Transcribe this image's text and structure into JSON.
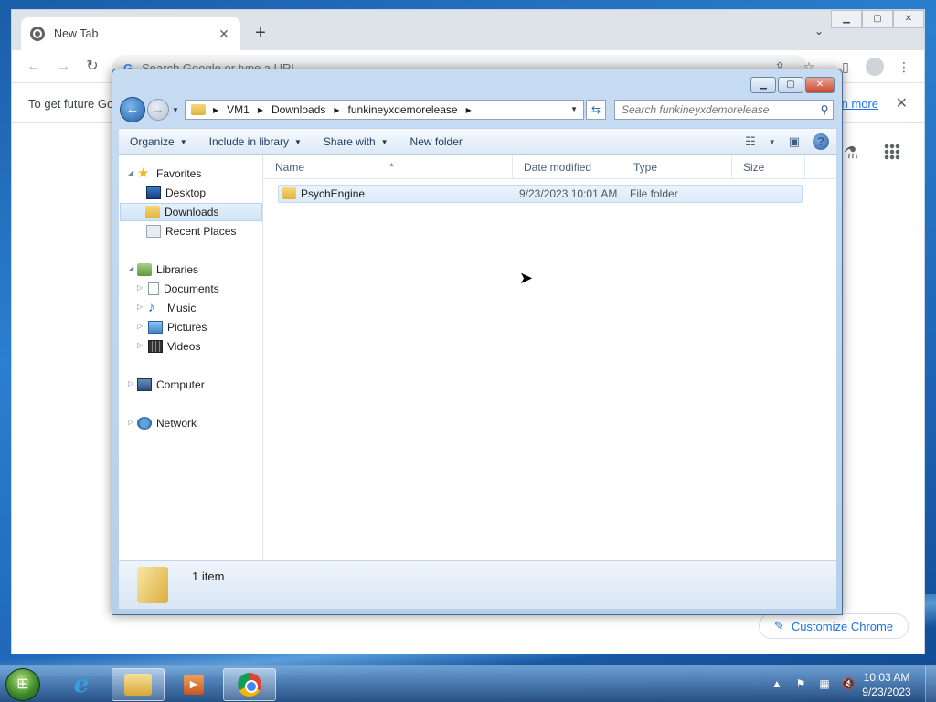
{
  "chrome": {
    "tab_title": "New Tab",
    "tab_close": "✕",
    "new_tab": "+",
    "omnibox_placeholder": "Search Google or type a URL",
    "omnibox_icon": "G",
    "infobar_text": "To get future Go",
    "infobar_link": "n more",
    "customize_label": "Customize Chrome",
    "icons": [
      "back-arrow-icon",
      "forward-arrow-icon",
      "reload-icon",
      "share-icon",
      "bookmark-star-icon",
      "side-panel-icon",
      "profile-avatar-icon",
      "kebab-menu-icon",
      "labs-flask-icon",
      "apps-grid-icon"
    ]
  },
  "explorer": {
    "breadcrumb": [
      "VM1",
      "Downloads",
      "funkineyxdemorelease"
    ],
    "search_placeholder": "Search funkineyxdemorelease",
    "commands": {
      "organize": "Organize",
      "include_in_library": "Include in library",
      "share_with": "Share with",
      "new_folder": "New folder"
    },
    "nav": {
      "favorites": "Favorites",
      "desktop": "Desktop",
      "downloads": "Downloads",
      "recent_places": "Recent Places",
      "libraries": "Libraries",
      "documents": "Documents",
      "music": "Music",
      "pictures": "Pictures",
      "videos": "Videos",
      "computer": "Computer",
      "network": "Network"
    },
    "columns": {
      "name": "Name",
      "date_modified": "Date modified",
      "type": "Type",
      "size": "Size"
    },
    "files": [
      {
        "name": "PsychEngine",
        "date_modified": "9/23/2023 10:01 AM",
        "type": "File folder",
        "size": ""
      }
    ],
    "status": "1 item"
  },
  "taskbar": {
    "time": "10:03 AM",
    "date": "9/23/2023",
    "pinned": [
      "internet-explorer-icon",
      "windows-explorer-icon",
      "media-player-icon",
      "chrome-icon"
    ],
    "tray_icons": [
      "show-hidden-icons-icon",
      "action-center-icon",
      "network-icon",
      "volume-muted-icon"
    ]
  }
}
